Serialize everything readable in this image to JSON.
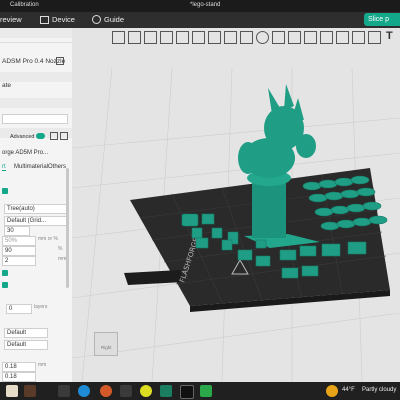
{
  "window": {
    "app_title": "Calibration",
    "file_title": "*lego-stand"
  },
  "menu": {
    "preview": "review",
    "device": "Device",
    "guide": "Guide",
    "slice": "Slice p"
  },
  "sidebar": {
    "printer_name": "ADSM Pro 0.4 Nozzle",
    "plate_label": "ate",
    "advanced_label": "Advanced",
    "filament_name": "orge AD5M Pro...",
    "tabs": [
      "rt",
      "Multimaterial",
      "Others"
    ],
    "support_type": "Tree(auto)",
    "support_style": "Default (Grid...",
    "threshold_angle": "30",
    "density_value": "50%",
    "density_unit": "mm or %",
    "angle_value": "90",
    "angle_unit": "%",
    "top_z": "2",
    "top_z_unit": "mm",
    "layers_value": "0",
    "layers_unit": "layers",
    "pattern_a": "Default",
    "pattern_b": "Default",
    "dist_a": "0.18",
    "dist_b": "0.18",
    "dist_unit": "mm"
  },
  "viewport": {
    "plate_brand": "FLASHFORGE",
    "cube_label": "Right"
  },
  "taskbar": {
    "temperature": "44°F",
    "weather": "Partly cloudy"
  },
  "colors": {
    "accent": "#14a88a",
    "model": "#1f9e85",
    "plate": "#2a2a2a"
  }
}
